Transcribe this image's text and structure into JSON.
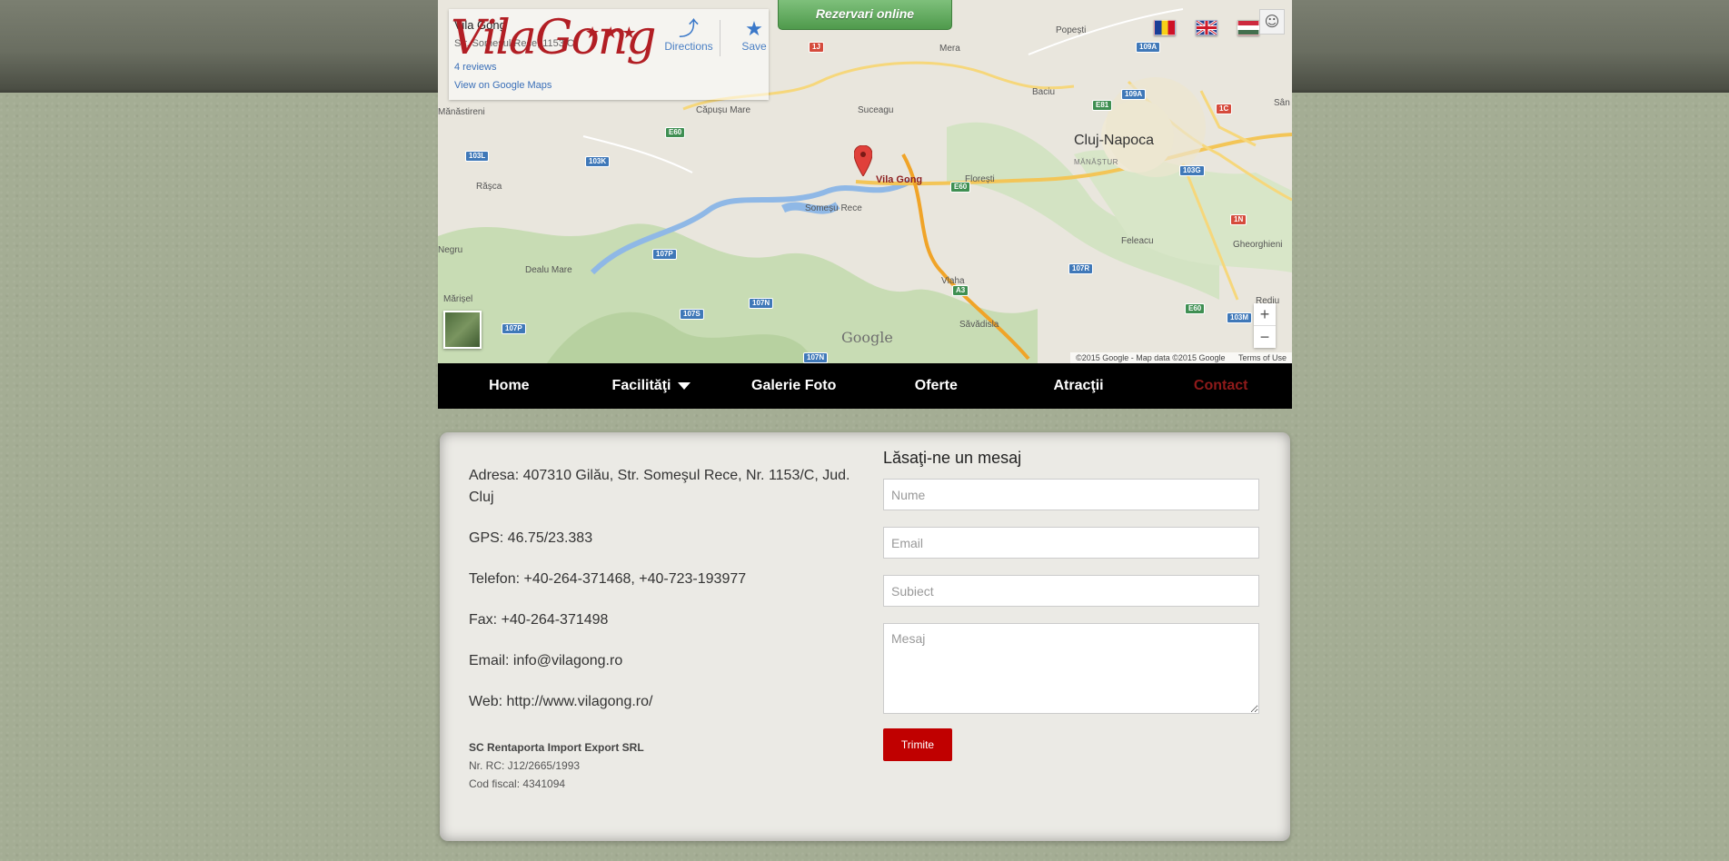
{
  "header": {
    "booking_button": "Rezervari online",
    "logo_text": "VilaGong",
    "logo_stars": "★★★",
    "languages": [
      "Română",
      "English",
      "Magyar"
    ]
  },
  "map": {
    "infobox": {
      "place_name": "Vila Gong",
      "address": "Str. Someșul Rece, 1153/C",
      "reviews": "4 reviews",
      "view_link": "View on Google Maps",
      "directions": "Directions",
      "save": "Save"
    },
    "marker_label": "Vila Gong",
    "places": [
      "Popești",
      "Mera",
      "Baciu",
      "Sân",
      "Mănăstireni",
      "Căpușu Mare",
      "Suceagu",
      "Cluj-Napoca",
      "MĂNĂȘTUR",
      "Florești",
      "Răşca",
      "Someșu Rece",
      "Dealu Mare",
      "Negru",
      "Feleacu",
      "Gheorghieni",
      "Vlaha",
      "Săvădisla",
      "Mărișel",
      "Rediu"
    ],
    "roads": [
      "1J",
      "109A",
      "E81",
      "109A",
      "1C",
      "E60",
      "103L",
      "103K",
      "E60",
      "103G",
      "1N",
      "107P",
      "107R",
      "A3",
      "E60",
      "107N",
      "107S",
      "107P",
      "103M",
      "107N"
    ],
    "google_logo": "Google",
    "attribution": "©2015 Google - Map data ©2015 Google",
    "terms": "Terms of Use",
    "zoom_in": "+",
    "zoom_out": "−"
  },
  "nav": {
    "items": [
      "Home",
      "Facilităţi",
      "Galerie Foto",
      "Oferte",
      "Atracţii",
      "Contact"
    ],
    "active": "Contact"
  },
  "contact": {
    "address": "Adresa: 407310 Gilău, Str. Someşul Rece, Nr. 1153/C, Jud. Cluj",
    "gps": "GPS: 46.75/23.383",
    "phone": "Telefon: +40-264-371468, +40-723-193977",
    "fax": "Fax: +40-264-371498",
    "email": "Email: info@vilagong.ro",
    "web": "Web: http://www.vilagong.ro/",
    "company_name": "SC Rentaporta Import Export SRL",
    "company_rc": "Nr. RC: J12/2665/1993",
    "company_cif": "Cod fiscal: 4341094"
  },
  "form": {
    "title": "Lăsaţi-ne un mesaj",
    "name_placeholder": "Nume",
    "email_placeholder": "Email",
    "subject_placeholder": "Subiect",
    "message_placeholder": "Mesaj",
    "submit_label": "Trimite"
  },
  "colors": {
    "background": "#a4ad94",
    "nav_background": "#000000",
    "nav_active": "#8f1a1a",
    "submit_button": "#c00000",
    "booking_button": "#5aa757",
    "logo": "#b21e24"
  }
}
